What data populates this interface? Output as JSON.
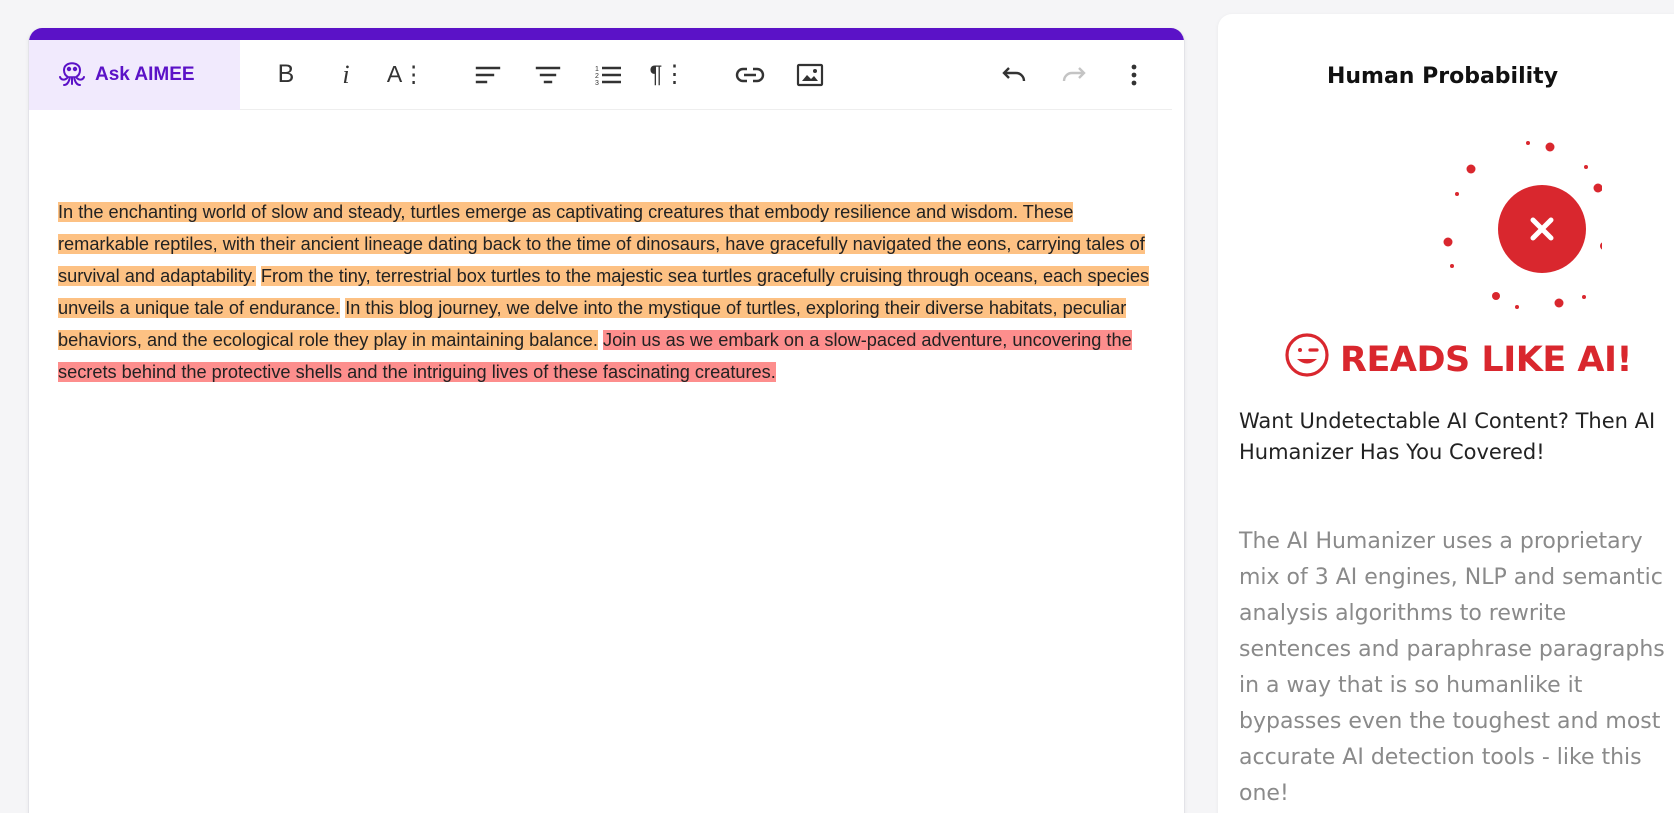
{
  "toolbar": {
    "ask_label": "Ask AIMEE",
    "bold_glyph": "B",
    "italic_glyph": "i",
    "size_glyph": "A⋮",
    "paragraph_glyph": "¶⋮"
  },
  "colors": {
    "accent": "#5b12c7",
    "ask_background": "#f1eafd",
    "highlight_orange": "#fdc183",
    "highlight_red": "#fd8e8d",
    "verdict_red": "#d9272e"
  },
  "icons": {
    "assistant": "octopus-icon",
    "align_left": "align-left-icon",
    "align_center": "align-center-icon",
    "ordered_list": "ordered-list-icon",
    "link": "link-icon",
    "image": "image-icon",
    "undo": "undo-icon",
    "redo": "redo-icon",
    "more": "more-vertical-icon",
    "verdict": "close-icon",
    "emoji": "wink-face-icon"
  },
  "editor": {
    "segments": [
      {
        "text": "In the enchanting world of slow and steady, turtles emerge as captivating creatures that embody resilience and wisdom. These remarkable reptiles, with their ancient lineage dating back to the time of dinosaurs, have gracefully navigated the eons, carrying tales of survival and adaptability.",
        "level": "orange"
      },
      {
        "text": "From the tiny, terrestrial box turtles to the majestic sea turtles gracefully cruising through oceans, each species unveils a unique tale of endurance.",
        "level": "orange"
      },
      {
        "text": "In this blog journey, we delve into the mystique of turtles, exploring their diverse habitats, peculiar behaviors, and the ecological role they play in maintaining balance.",
        "level": "orange"
      },
      {
        "text": "Join us as we embark on a slow-paced adventure, uncovering the secrets behind the protective shells and the intriguing lives of these fascinating creatures.",
        "level": "red"
      }
    ]
  },
  "sidebar": {
    "title": "Human Probability",
    "verdict": "READS LIKE AI!",
    "promo_heading": "Want Undetectable AI Content? Then AI Humanizer Has You Covered!",
    "promo_body": "The AI Humanizer uses a proprietary mix of 3 AI engines, NLP and semantic analysis algorithms to rewrite sentences and paraphrase paragraphs in a way that is so humanlike it bypasses even the toughest and most accurate AI detection tools - like this one!"
  }
}
